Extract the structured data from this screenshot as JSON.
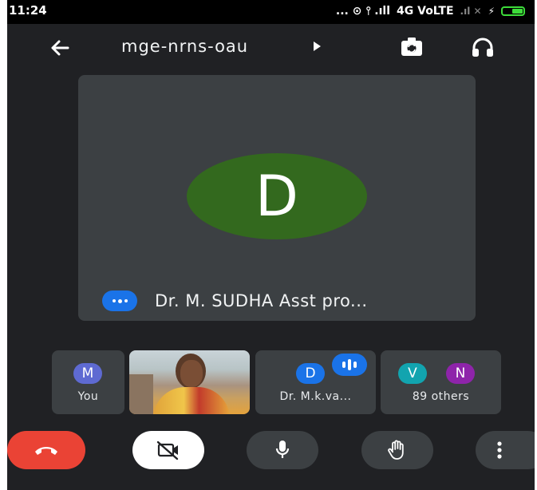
{
  "status_bar": {
    "time": "11:24",
    "indicators": "... ⊙ ⫯ .ıll",
    "network": "4G VoLTE",
    "secondary": ".ıl ✕"
  },
  "top_bar": {
    "meeting_code": "mge-nrns-oau"
  },
  "main_tile": {
    "avatar_letter": "D",
    "avatar_color": "#33691e",
    "participant_name": "Dr. M. SUDHA Asst pro..."
  },
  "participants": [
    {
      "avatar_letter": "M",
      "avatar_color": "#5e6ad2",
      "label": "You"
    },
    {
      "label": ""
    },
    {
      "avatar_letter": "D",
      "avatar_color": "#1a73e8",
      "label": "Dr. M.k.va..."
    },
    {
      "avatar_letters": [
        "V",
        "N"
      ],
      "avatar_colors": [
        "#12a4af",
        "#8e24aa"
      ],
      "label": "89 others"
    }
  ],
  "controls": {
    "end_call_color": "#ea4335"
  }
}
